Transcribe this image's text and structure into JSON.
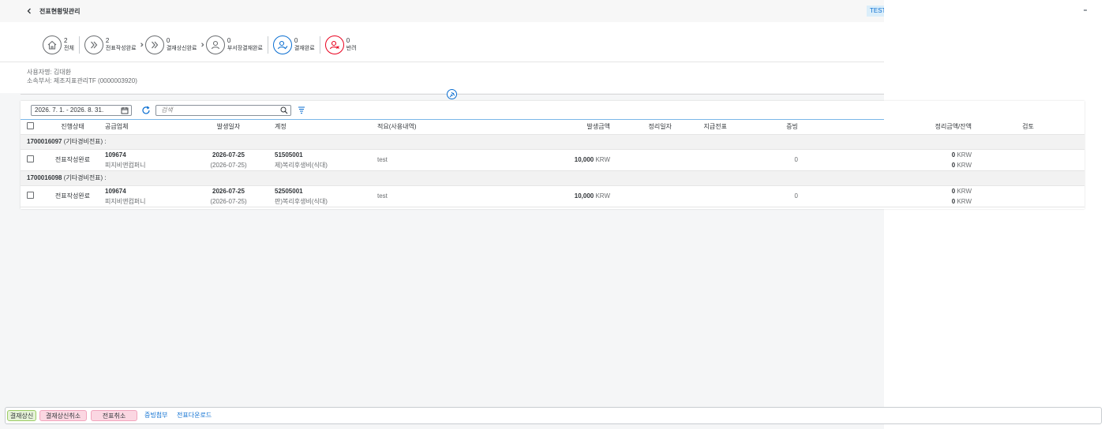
{
  "header": {
    "title": "전표현황및관리",
    "badge": "TEST"
  },
  "steps": [
    {
      "count": "2",
      "label": "전체",
      "icon": "home-icon"
    },
    {
      "count": "2",
      "label": "전표작성완료",
      "icon": "forward-icon"
    },
    {
      "count": "0",
      "label": "결재상신완료",
      "icon": "forward-icon"
    },
    {
      "count": "0",
      "label": "부서장결재완료",
      "icon": "user-icon"
    },
    {
      "count": "0",
      "label": "결재완료",
      "icon": "user-check-icon"
    },
    {
      "count": "0",
      "label": "반려",
      "icon": "user-reject-icon"
    }
  ],
  "user": {
    "name_line": "사용자명: 김대환",
    "dept_line": "소속부서: 제조지표관리TF (0000003920)"
  },
  "toolbar": {
    "date_range": "2026. 7. 1. - 2026. 8. 31.",
    "search_placeholder": "검색"
  },
  "columns": [
    "진행상태",
    "공급업체",
    "발생일자",
    "계정",
    "적요(사용내역)",
    "발생금액",
    "정리일자",
    "지급전표",
    "증빙",
    "정리금액/잔액",
    "검토"
  ],
  "groups": [
    {
      "doc_no": "1700016097",
      "doc_type": " (기타경비전표) :",
      "row": {
        "status": "전표작성완료",
        "vendor_code": "109674",
        "vendor_name": "피지비앤컴퍼니",
        "date": "2026-07-25",
        "date_sub": "(2026-07-25)",
        "account_code": "51505001",
        "account_name": "제)복리후생비(식대)",
        "desc": "test",
        "amount": "10,000",
        "amount_unit": "KRW",
        "evidence": "0",
        "settle_amount": "0",
        "settle_unit": "KRW",
        "balance": "0",
        "balance_unit": "KRW"
      }
    },
    {
      "doc_no": "1700016098",
      "doc_type": " (기타경비전표) :",
      "row": {
        "status": "전표작성완료",
        "vendor_code": "109674",
        "vendor_name": "피지비앤컴퍼니",
        "date": "2026-07-25",
        "date_sub": "(2026-07-25)",
        "account_code": "52505001",
        "account_name": "판)복리후생비(식대)",
        "desc": "test",
        "amount": "10,000",
        "amount_unit": "KRW",
        "evidence": "0",
        "settle_amount": "0",
        "settle_unit": "KRW",
        "balance": "0",
        "balance_unit": "KRW"
      }
    }
  ],
  "footer": {
    "submit": "결재상신",
    "cancel_submit": "결재상신취소",
    "cancel_doc": "전표취소",
    "attach": "증빙첨부",
    "download": "전표다운로드"
  }
}
